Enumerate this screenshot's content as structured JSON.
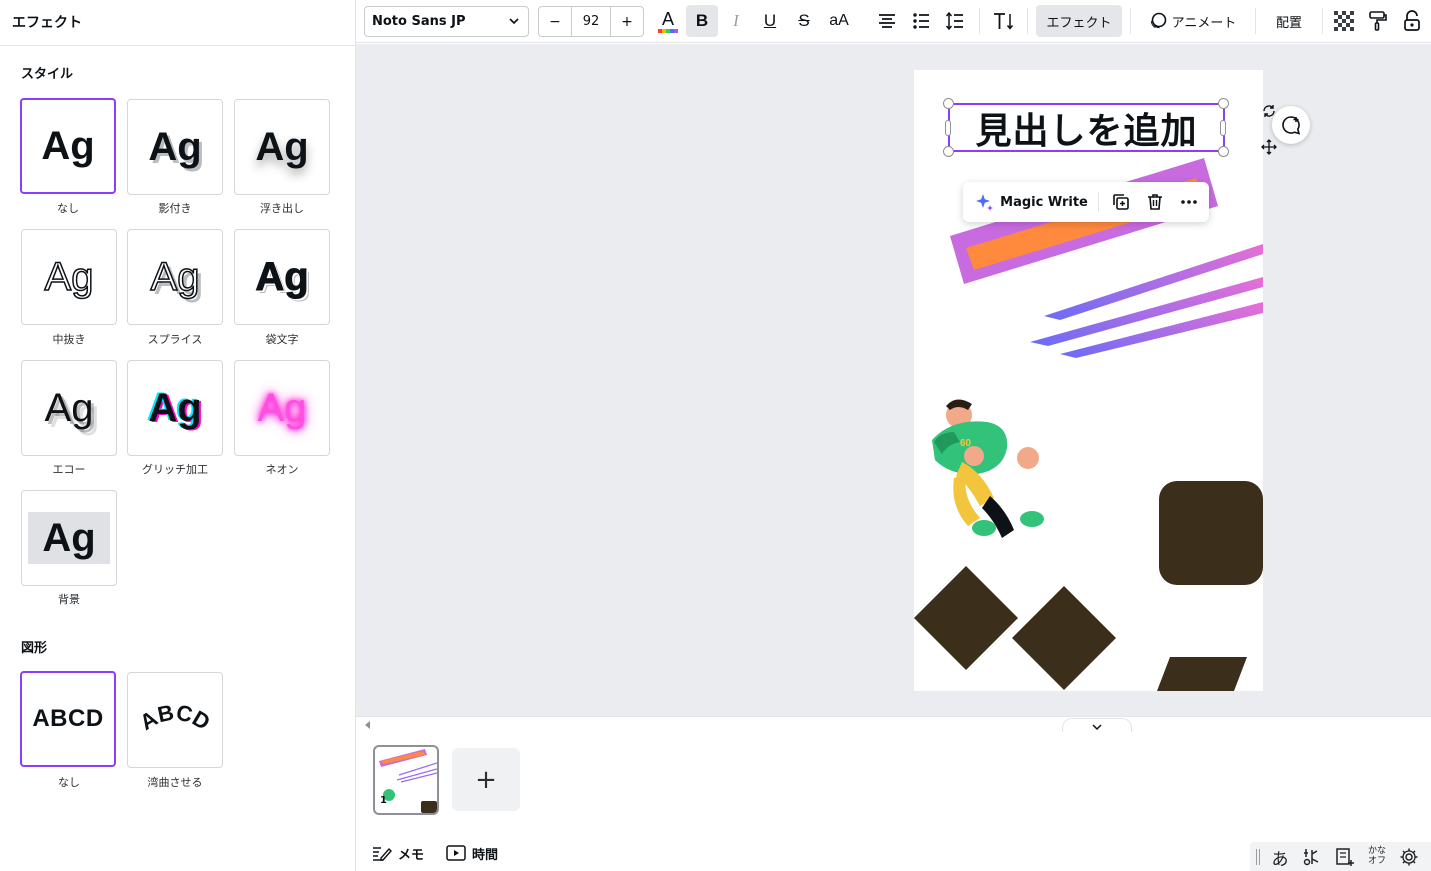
{
  "panel": {
    "title": "エフェクト",
    "styles_title": "スタイル",
    "shapes_title": "図形",
    "style_sample": "Ag",
    "shape_sample": "ABCD",
    "styles": [
      {
        "label": "なし",
        "selected": true
      },
      {
        "label": "影付き",
        "selected": false
      },
      {
        "label": "浮き出し",
        "selected": false
      },
      {
        "label": "中抜き",
        "selected": false
      },
      {
        "label": "スプライス",
        "selected": false
      },
      {
        "label": "袋文字",
        "selected": false
      },
      {
        "label": "エコー",
        "selected": false
      },
      {
        "label": "グリッチ加工",
        "selected": false
      },
      {
        "label": "ネオン",
        "selected": false
      },
      {
        "label": "背景",
        "selected": false
      }
    ],
    "shapes": [
      {
        "label": "なし",
        "selected": true
      },
      {
        "label": "湾曲させる",
        "selected": false
      }
    ]
  },
  "toolbar": {
    "font_family": "Noto Sans JP",
    "font_size": "92",
    "decrease": "−",
    "increase": "+",
    "bold": "B",
    "italic": "I",
    "underline": "U",
    "strike": "S",
    "case": "aA",
    "effects": "エフェクト",
    "animate": "アニメート",
    "position": "配置"
  },
  "canvas": {
    "heading_text": "見出しを追加",
    "context_menu": {
      "magic_write": "Magic Write"
    },
    "colors": {
      "accent": "#8b3dff",
      "purple": "#c86be0",
      "orange": "#ff8a3d",
      "brown": "#3b2f1c",
      "stripe_start": "#6a6cf6",
      "stripe_end": "#e86fd6"
    }
  },
  "pages": {
    "current_page_number": "1",
    "add_page": "+"
  },
  "bottom": {
    "notes": "メモ",
    "timing": "時間"
  },
  "ime": {
    "hiragana": "あ",
    "kana_off_top": "かな",
    "kana_off_bottom": "オフ"
  }
}
